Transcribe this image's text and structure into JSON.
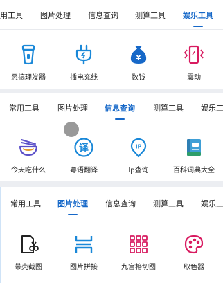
{
  "panels": [
    {
      "tabs": [
        {
          "label": "用工具"
        },
        {
          "label": "图片处理"
        },
        {
          "label": "信息查询"
        },
        {
          "label": "测算工具"
        },
        {
          "label": "娱乐工具"
        }
      ],
      "active_tab": "娱乐工具",
      "items": [
        {
          "label": "恶搞理发器",
          "icon": "hair-clipper-icon",
          "color": "#1a88d8"
        },
        {
          "label": "插电充线",
          "icon": "charging-plug-icon",
          "color": "#1a88d8"
        },
        {
          "label": "数钱",
          "icon": "money-bag-icon",
          "color": "#1668c8"
        },
        {
          "label": "震动",
          "icon": "vibrate-phone-icon",
          "color": "#d81b60"
        }
      ]
    },
    {
      "tabs": [
        {
          "label": "常用工具"
        },
        {
          "label": "图片处理"
        },
        {
          "label": "信息查询"
        },
        {
          "label": "测算工具"
        },
        {
          "label": "娱乐工"
        }
      ],
      "active_tab": "信息查询",
      "items": [
        {
          "label": "今天吃什么",
          "icon": "noodle-bowl-icon",
          "color": "#5b4fc8"
        },
        {
          "label": "粤语翻译",
          "icon": "translate-icon",
          "color": "#1a88d8",
          "glyph": "译"
        },
        {
          "label": "Ip查询",
          "icon": "ip-location-icon",
          "color": "#1a88d8",
          "glyph": "IP"
        },
        {
          "label": "百科词典大全",
          "icon": "encyclopedia-book-icon",
          "color": "#2e9e6a"
        }
      ]
    },
    {
      "tabs": [
        {
          "label": "常用工具"
        },
        {
          "label": "图片处理"
        },
        {
          "label": "信息查询"
        },
        {
          "label": "测算工具"
        },
        {
          "label": "娱乐工"
        }
      ],
      "active_tab": "图片处理",
      "items": [
        {
          "label": "带壳截图",
          "icon": "screenshot-scissors-icon",
          "color": "#222222"
        },
        {
          "label": "图片拼接",
          "icon": "image-stitch-icon",
          "color": "#1a88d8"
        },
        {
          "label": "九宫格切图",
          "icon": "nine-grid-icon",
          "color": "#d81b60"
        },
        {
          "label": "取色器",
          "icon": "color-palette-icon",
          "color": "#d81b60"
        }
      ]
    }
  ],
  "colors": {
    "accent": "#1668c8",
    "divider": "#eceef2"
  }
}
